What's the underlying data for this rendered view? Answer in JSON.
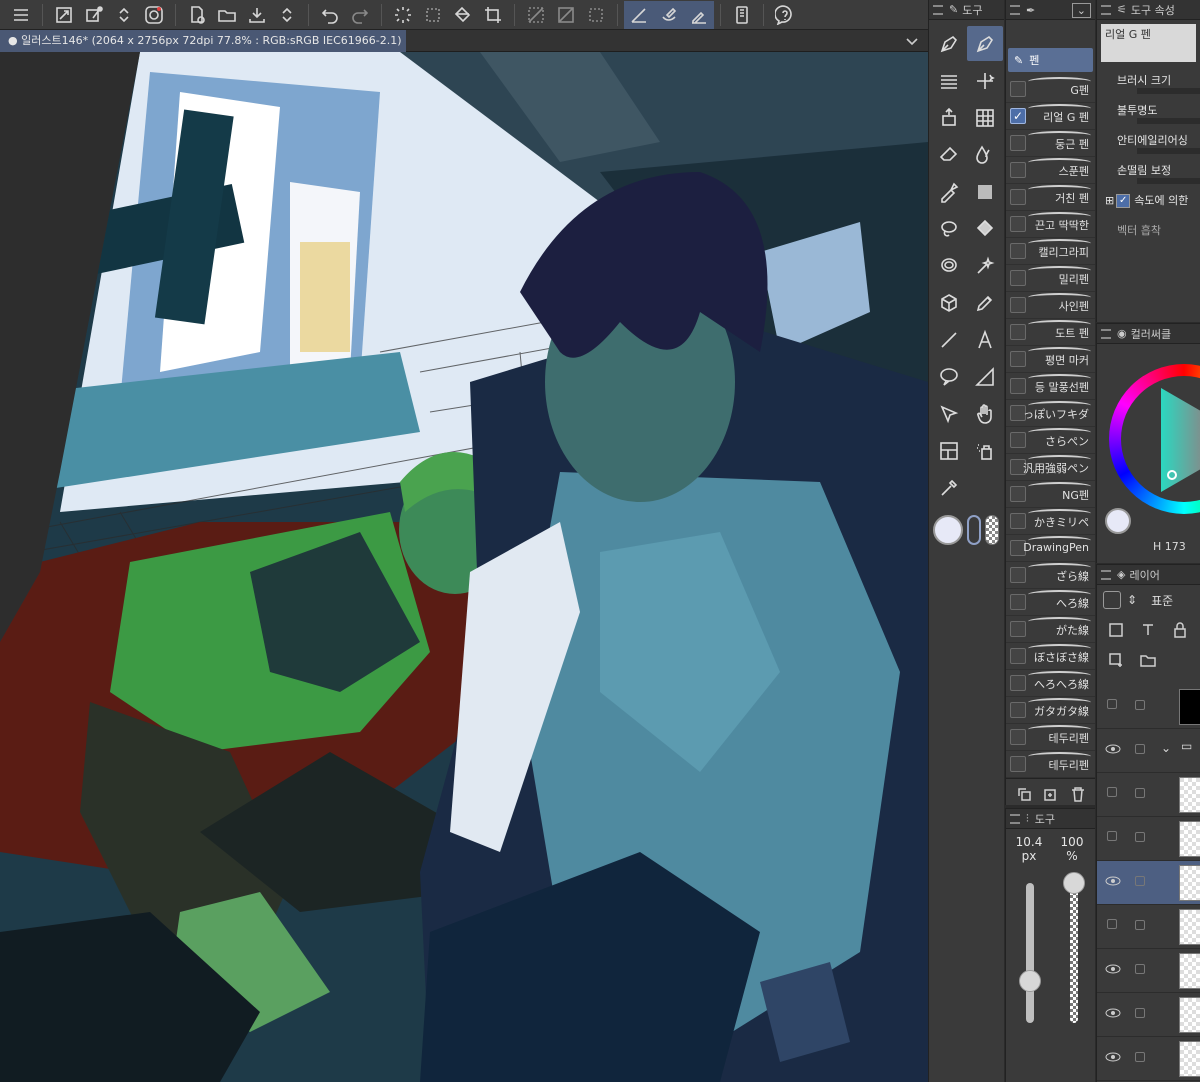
{
  "toolbar": {
    "icons": [
      "menu-icon",
      "fit-icon",
      "new-layer-icon",
      "up-down-icon",
      "spiral-icon",
      "new-file-icon",
      "open-folder-icon",
      "save-icon",
      "up-down-icon",
      "undo-icon",
      "redo-icon",
      "loading-icon",
      "selection-icon",
      "fill-icon",
      "transform-icon",
      "clear-selection-icon",
      "invert-icon",
      "deselect-icon",
      "pen-tool-icon",
      "brush-tool-icon",
      "pencil-tool-icon",
      "phone-icon",
      "help-icon"
    ]
  },
  "document": {
    "tab_title": "일러스트146* (2064 x 2756px 72dpi 77.8% : RGB:sRGB IEC61966-2.1)"
  },
  "tool_panel": {
    "header": "도구"
  },
  "subtool_panel": {
    "header": "",
    "group_label": "펜",
    "brushes": [
      {
        "name": "G펜",
        "checked": false
      },
      {
        "name": "리얼 G 펜",
        "checked": true
      },
      {
        "name": "둥근 펜",
        "checked": false
      },
      {
        "name": "스푼펜",
        "checked": false
      },
      {
        "name": "거친 펜",
        "checked": false
      },
      {
        "name": "끈고 딱딱한",
        "checked": false
      },
      {
        "name": "캘리그라피",
        "checked": false
      },
      {
        "name": "밀리펜",
        "checked": false
      },
      {
        "name": "사인펜",
        "checked": false
      },
      {
        "name": "도트 펜",
        "checked": false
      },
      {
        "name": "평면 마커",
        "checked": false
      },
      {
        "name": "등 말풍선펜",
        "checked": false
      },
      {
        "name": "っぽいフキダ",
        "checked": false
      },
      {
        "name": "さらぺン",
        "checked": false
      },
      {
        "name": "汎用強弱ペン",
        "checked": false
      },
      {
        "name": "NG펜",
        "checked": false
      },
      {
        "name": "かきミリペ",
        "checked": false
      },
      {
        "name": "DrawingPen",
        "checked": false
      },
      {
        "name": "ざら線",
        "checked": false
      },
      {
        "name": "へろ線",
        "checked": false
      },
      {
        "name": "がた線",
        "checked": false
      },
      {
        "name": "ぼさぼさ線",
        "checked": false
      },
      {
        "name": "へろへろ線",
        "checked": false
      },
      {
        "name": "ガタガタ線",
        "checked": false
      },
      {
        "name": "테두리펜",
        "checked": false
      },
      {
        "name": "테두리펜",
        "checked": false
      }
    ]
  },
  "brush_size": {
    "header": "도구",
    "size_value": "10.4",
    "size_unit": "px",
    "opacity_value": "100",
    "opacity_unit": "%",
    "size_level": 0.3,
    "opacity_level": 1.0
  },
  "properties": {
    "header": "도구 속성",
    "brush_name": "리얼 G 펜",
    "rows": [
      "브러시 크기",
      "불투명도",
      "안티에일리어싱",
      "손떨림 보정"
    ],
    "checkbox_label": "속도에 의한",
    "vector_label": "벡터 흡착"
  },
  "color_panel": {
    "header": "컬러써클",
    "h_label": "H",
    "h_value": "173"
  },
  "layer_panel": {
    "header": "레이어",
    "blend_mode": "표준"
  }
}
